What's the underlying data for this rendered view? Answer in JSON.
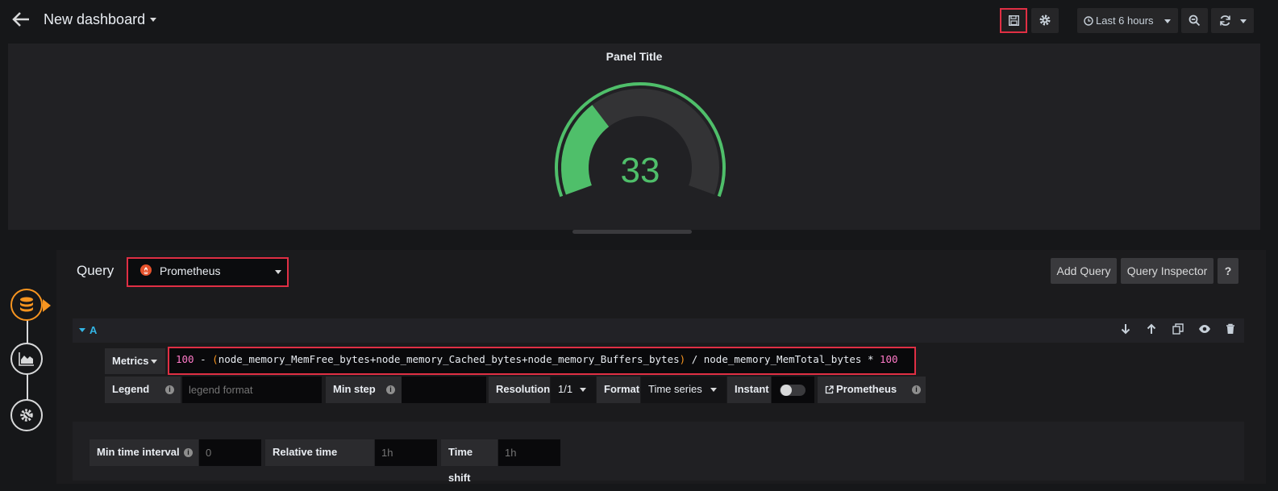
{
  "header": {
    "back_icon": "arrow-left-icon",
    "title": "New dashboard",
    "time_range": "Last 6 hours"
  },
  "panel": {
    "title": "Panel Title",
    "gauge": {
      "value": 33,
      "min": 0,
      "max": 100,
      "value_color": "#4fbf6a",
      "threshold_color": "#4fbf6a"
    }
  },
  "query": {
    "label": "Query",
    "datasource": "Prometheus",
    "buttons": {
      "add_query": "Add Query",
      "query_inspector": "Query Inspector",
      "help": "?"
    },
    "row": {
      "ref_id": "A",
      "metrics_label": "Metrics",
      "expr_parts": {
        "p1": "100",
        "p2": " - ",
        "p3": "(",
        "p4": "node_memory_MemFree_bytes+node_memory_Cached_bytes+node_memory_Buffers_bytes",
        "p5": ")",
        "p6": " / node_memory_MemTotal_bytes * ",
        "p7": "100"
      },
      "legend_label": "Legend",
      "legend_placeholder": "legend format",
      "min_step_label": "Min step",
      "resolution_label": "Resolution",
      "resolution_value": "1/1",
      "format_label": "Format",
      "format_value": "Time series",
      "instant_label": "Instant",
      "instant_enabled": false,
      "prometheus_link": "Prometheus"
    },
    "options": {
      "min_time_interval_label": "Min time interval",
      "min_time_interval_placeholder": "0",
      "relative_time_label": "Relative time",
      "relative_time_placeholder": "1h",
      "time_shift_label": "Time shift",
      "time_shift_placeholder": "1h"
    }
  },
  "colors": {
    "accent_orange": "#f79520",
    "highlight_red": "#e02f44",
    "ref_blue": "#33b5e5"
  }
}
